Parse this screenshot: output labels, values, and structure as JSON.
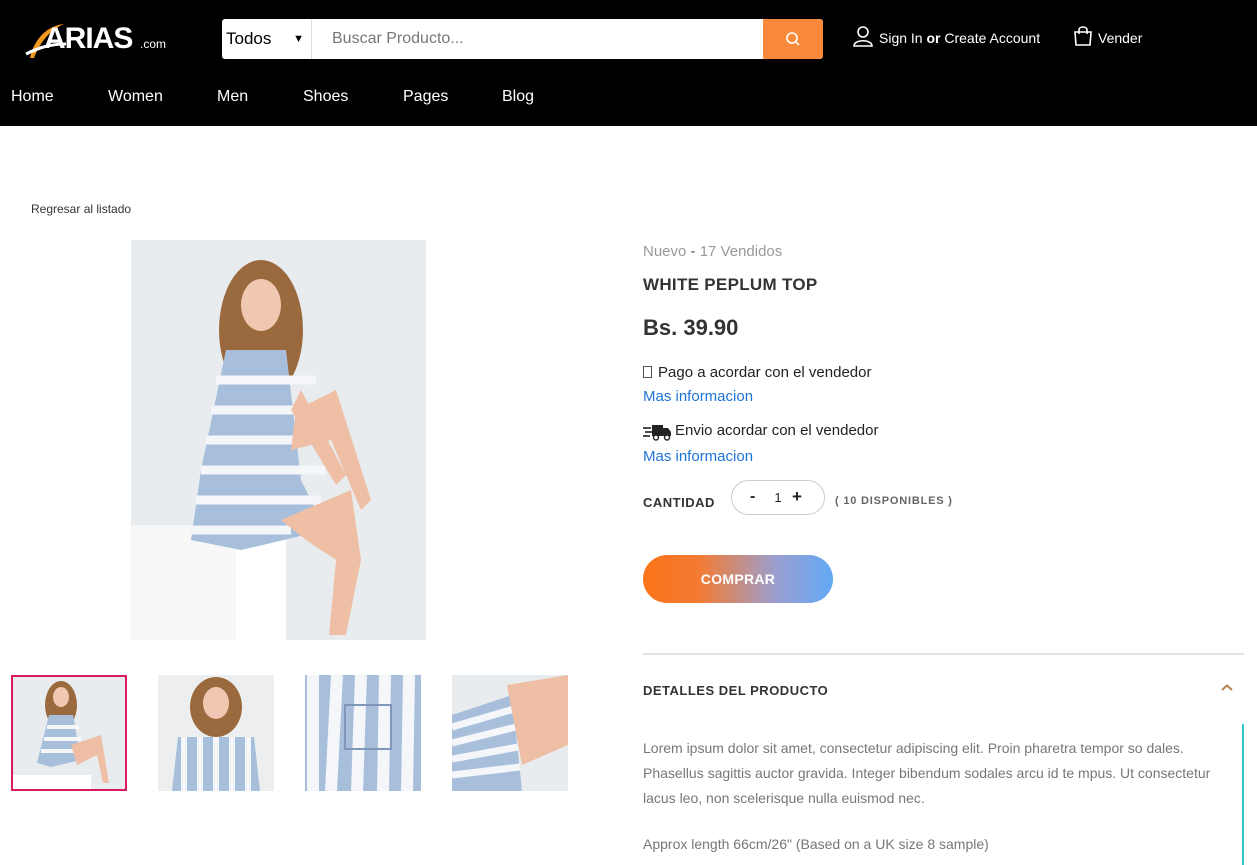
{
  "header": {
    "logo_main": "ARIAS",
    "logo_suffix": ".com",
    "search": {
      "category": "Todos",
      "placeholder": "Buscar Producto..."
    },
    "account": {
      "sign_in": "Sign In",
      "or": "or",
      "create": "Create Account"
    },
    "sell_label": "Vender",
    "nav": [
      "Home",
      "Women",
      "Men",
      "Shoes",
      "Pages",
      "Blog"
    ]
  },
  "breadcrumb": {
    "back_label": "Regresar al listado"
  },
  "product": {
    "condition": "Nuevo",
    "sold": "17 Vendidos",
    "title": "WHITE PEPLUM TOP",
    "price": "Bs. 39.90",
    "payment_text": "Pago a acordar con el vendedor",
    "payment_more": "Mas informacion",
    "shipping_text": "Envio acordar con el vendedor",
    "shipping_more": "Mas informacion",
    "quantity_label": "CANTIDAD",
    "quantity_minus": "-",
    "quantity_value": "1",
    "quantity_plus": "+",
    "available": "( 10 DISPONIBLES )",
    "buy_label": "COMPRAR",
    "details_heading": "DETALLES DEL PRODUCTO",
    "description": "Lorem ipsum dolor sit amet, consectetur adipiscing elit. Proin pharetra tempor so dales. Phasellus sagittis auctor gravida. Integer bibendum sodales arcu id te mpus. Ut consectetur lacus leo, non scelerisque nulla euismod nec.",
    "approx_length": "Approx length 66cm/26\" (Based on a UK size 8 sample)"
  },
  "colors": {
    "header_bg": "#000000",
    "search_button": "#fa8a3a",
    "link": "#1e74d6",
    "active_thumb_border": "#d81b60",
    "buy_gradient_start": "#fb7318",
    "buy_gradient_end": "#63a9f5",
    "details_accent": "#2fc6cf"
  }
}
